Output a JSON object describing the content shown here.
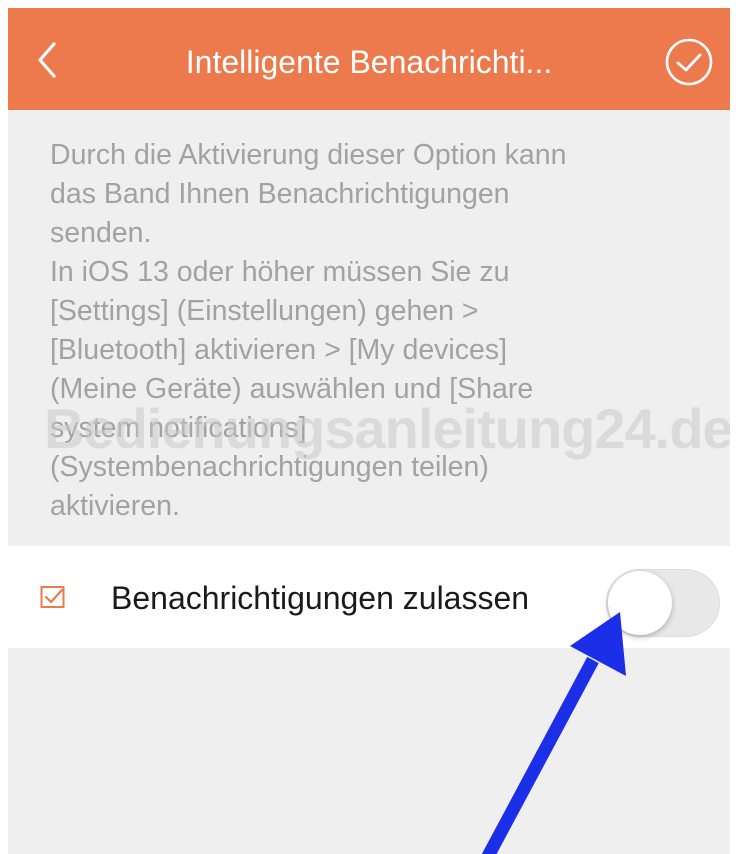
{
  "header": {
    "title": "Intelligente Benachrichti...",
    "back_icon": "chevron-left-icon",
    "confirm_icon": "check-circle-icon",
    "background_color": "#ec7a4d"
  },
  "description": {
    "lines": [
      "Durch die Aktivierung dieser Option kann",
      "das Band Ihnen Benachrichtigungen",
      "senden.",
      "In iOS 13 oder höher müssen Sie zu",
      "[Settings] (Einstellungen) gehen >",
      "[Bluetooth] aktivieren >  [My devices]",
      "(Meine Geräte) auswählen und [Share",
      "system notifications]",
      "(Systembenachrichtigungen teilen)",
      "aktivieren."
    ]
  },
  "watermark": "Bedienungsanleitung24.de",
  "setting": {
    "label": "Benachrichtigungen zulassen",
    "icon": "checkbox-icon",
    "toggle_on": false
  },
  "annotation": {
    "arrow_color": "#1b2ee8"
  }
}
